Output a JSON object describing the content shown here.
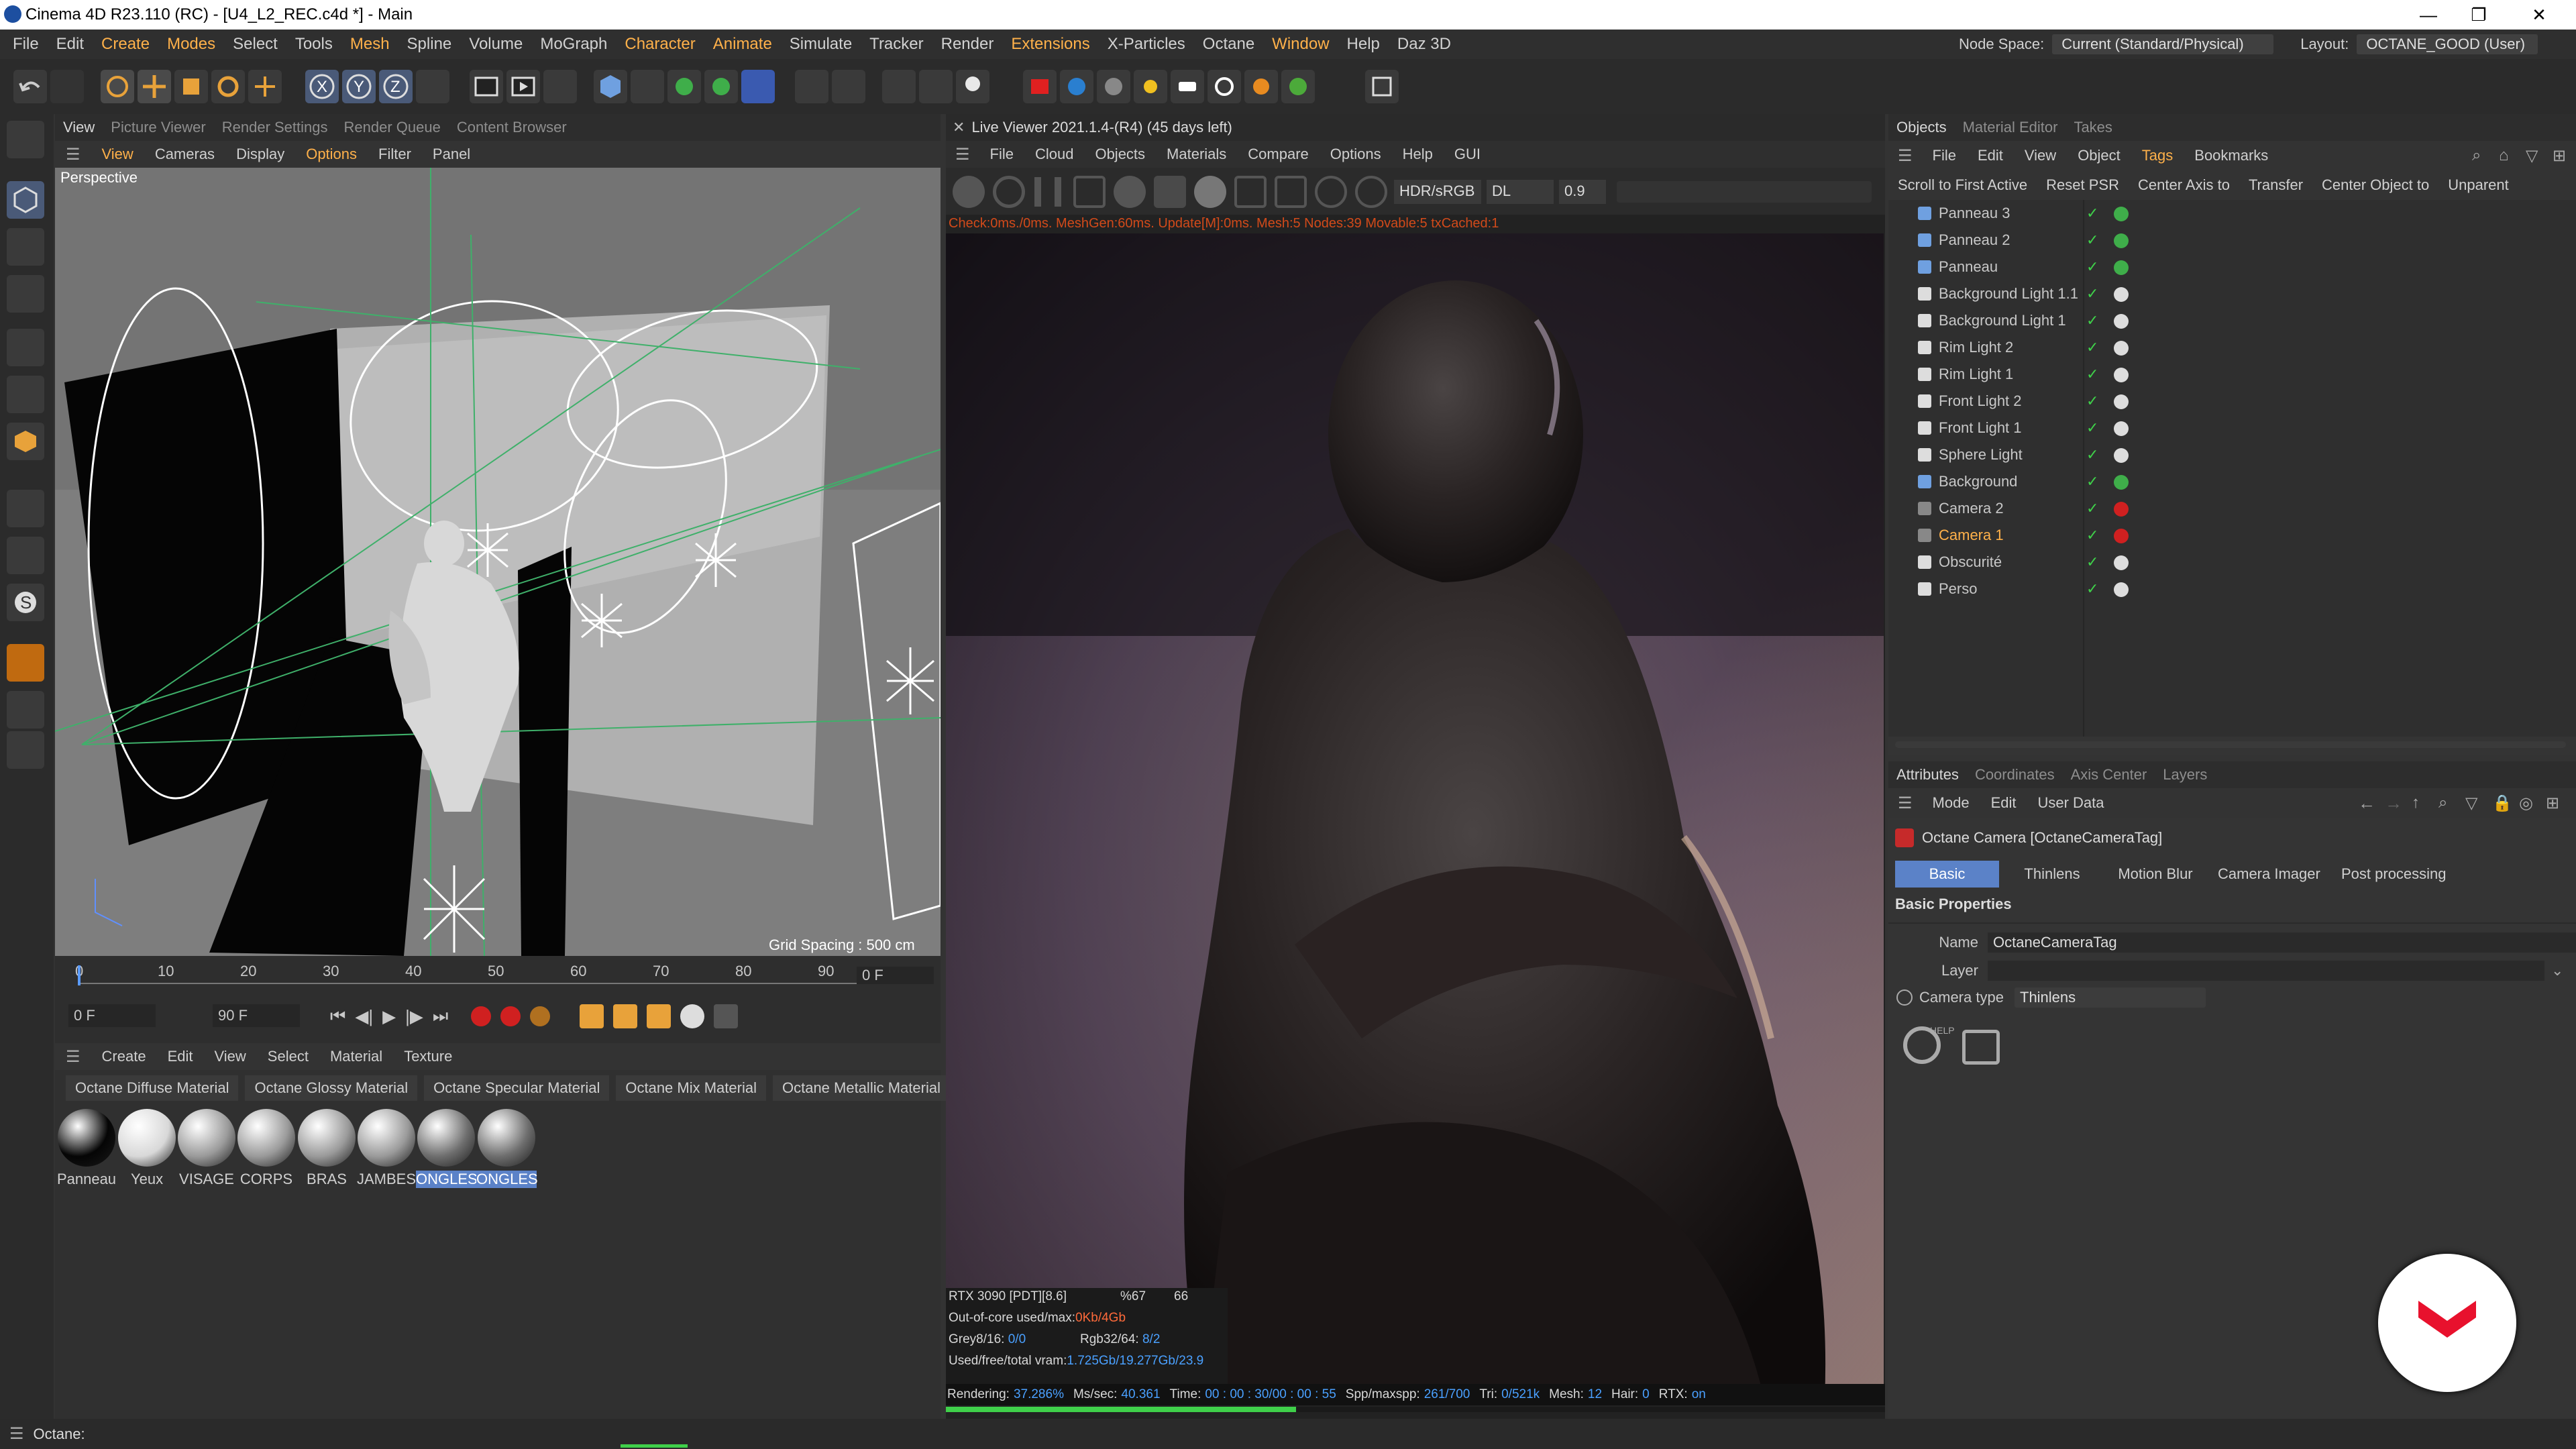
{
  "window": {
    "title": "Cinema 4D R23.110 (RC) - [U4_L2_REC.c4d *] - Main",
    "minimize": "—",
    "maximize": "❐",
    "close": "✕"
  },
  "menubar": {
    "items": [
      "File",
      "Edit",
      "Create",
      "Modes",
      "Select",
      "Tools",
      "Mesh",
      "Spline",
      "Volume",
      "MoGraph",
      "Character",
      "Animate",
      "Simulate",
      "Tracker",
      "Render",
      "Extensions",
      "X-Particles",
      "Octane",
      "Window",
      "Help",
      "Daz 3D"
    ],
    "node_space_label": "Node Space:",
    "node_space_value": "Current (Standard/Physical)",
    "layout_label": "Layout:",
    "layout_value": "OCTANE_GOOD (User)"
  },
  "viewport": {
    "tabs": [
      "View",
      "Picture Viewer",
      "Render Settings",
      "Render Queue",
      "Content Browser"
    ],
    "menu": [
      "View",
      "Cameras",
      "Display",
      "Options",
      "Filter",
      "Panel"
    ],
    "label": "Perspective",
    "grid_spacing": "Grid Spacing : 500 cm"
  },
  "timeline": {
    "ticks": [
      "0",
      "10",
      "20",
      "30",
      "40",
      "50",
      "60",
      "70",
      "80",
      "90"
    ],
    "frame_end": "0 F",
    "start": "0 F",
    "end": "90 F"
  },
  "material_manager": {
    "menu": [
      "Create",
      "Edit",
      "View",
      "Select",
      "Material",
      "Texture"
    ],
    "presets": [
      "Octane Diffuse Material",
      "Octane Glossy Material",
      "Octane Specular Material",
      "Octane Mix Material",
      "Octane Metallic Material"
    ],
    "materials": [
      {
        "name": "Panneau",
        "color": "#050505"
      },
      {
        "name": "Yeux",
        "color": "#d8d8d8"
      },
      {
        "name": "VISAGE",
        "color": "#9a9a9a"
      },
      {
        "name": "CORPS",
        "color": "#9a9a9a"
      },
      {
        "name": "BRAS",
        "color": "#9a9a9a"
      },
      {
        "name": "JAMBES",
        "color": "#9a9a9a"
      },
      {
        "name": "ONGLES",
        "color": "#6e6e6e"
      },
      {
        "name": "ONGLES",
        "color": "#6e6e6e"
      }
    ]
  },
  "live_viewer": {
    "title": "Live Viewer 2021.1.4-(R4) (45 days left)",
    "menu": [
      "File",
      "Cloud",
      "Objects",
      "Materials",
      "Compare",
      "Options",
      "Help",
      "GUI"
    ],
    "color_space": "HDR/sRGB",
    "kernel": "DL",
    "value": "0.9",
    "check_line": "Check:0ms./0ms. MeshGen:60ms. Update[M]:0ms. Mesh:5 Nodes:39 Movable:5 txCached:1",
    "gpu": "RTX 3090 [PDT][8.6]",
    "gpu_pct": "%67",
    "gpu_temp": "66",
    "ooc": "Out-of-core used/max:",
    "ooc_val": "0Kb/4Gb",
    "grey": "Grey8/16:",
    "grey_val": "0/0",
    "rgb": "Rgb32/64:",
    "rgb_val": "8/2",
    "vram": "Used/free/total vram:",
    "vram_val": "1.725Gb/19.277Gb/23.9",
    "rendering": "Rendering:",
    "rendering_pct": "37.286%",
    "ms": "Ms/sec:",
    "ms_val": "40.361",
    "time": "Time:",
    "time_val": "00 : 00 : 30/00 : 00 : 55",
    "spp": "Spp/maxspp:",
    "spp_val": "261/700",
    "tri": "Tri:",
    "tri_val": "0/521k",
    "mesh": "Mesh:",
    "mesh_val": "12",
    "hair": "Hair:",
    "hair_val": "0",
    "rtx": "RTX:",
    "rtx_val": "on",
    "progress": 0.37286
  },
  "objects": {
    "tabs": [
      "Objects",
      "Material Editor",
      "Takes"
    ],
    "menu": [
      "File",
      "Edit",
      "View",
      "Object",
      "Tags",
      "Bookmarks"
    ],
    "actions": [
      "Scroll to First Active",
      "Reset PSR",
      "Center Axis to",
      "Transfer",
      "Center Object to",
      "Unparent"
    ],
    "items": [
      {
        "name": "Panneau 3",
        "selected": false
      },
      {
        "name": "Panneau 2",
        "selected": false
      },
      {
        "name": "Panneau",
        "selected": false
      },
      {
        "name": "Background Light 1.1",
        "selected": false
      },
      {
        "name": "Background Light 1",
        "selected": false
      },
      {
        "name": "Rim Light 2",
        "selected": false
      },
      {
        "name": "Rim Light 1",
        "selected": false
      },
      {
        "name": "Front Light 2",
        "selected": false
      },
      {
        "name": "Front Light 1",
        "selected": false
      },
      {
        "name": "Sphere Light",
        "selected": false
      },
      {
        "name": "Background",
        "selected": false
      },
      {
        "name": "Camera 2",
        "selected": false
      },
      {
        "name": "Camera 1",
        "selected": true
      },
      {
        "name": "Obscurité",
        "selected": false
      },
      {
        "name": "Perso",
        "selected": false
      }
    ]
  },
  "attributes": {
    "tabs": [
      "Attributes",
      "Coordinates",
      "Axis Center",
      "Layers"
    ],
    "menu": [
      "Mode",
      "Edit",
      "User Data"
    ],
    "object_title": "Octane Camera [OctaneCameraTag]",
    "subtabs": [
      "Basic",
      "Thinlens",
      "Motion Blur",
      "Camera Imager",
      "Post processing"
    ],
    "section": "Basic Properties",
    "name_label": "Name",
    "name_value": "OctaneCameraTag",
    "layer_label": "Layer",
    "camera_type_label": "Camera type",
    "camera_type_value": "Thinlens",
    "help": "HELP"
  },
  "status": {
    "text": "Octane:"
  },
  "colors": {
    "accent": "#ffb14a",
    "selection": "#5b82c8",
    "brand": "#e8112d"
  }
}
